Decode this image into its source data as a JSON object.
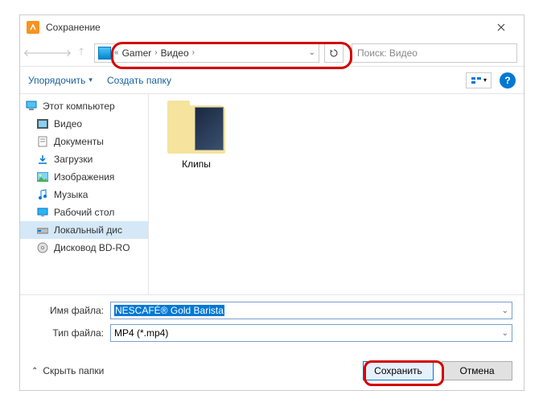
{
  "title": "Сохранение",
  "breadcrumb": {
    "parent": "Gamer",
    "current": "Видео",
    "sep_prefix": "«"
  },
  "search": {
    "placeholder": "Поиск: Видео"
  },
  "toolbar": {
    "organize": "Упорядочить",
    "new_folder": "Создать папку"
  },
  "tree": {
    "root": "Этот компьютер",
    "items": [
      "Видео",
      "Документы",
      "Загрузки",
      "Изображения",
      "Музыка",
      "Рабочий стол",
      "Локальный дис",
      "Дисковод BD-RO"
    ]
  },
  "folder_view": {
    "items": [
      {
        "name": "Клипы"
      }
    ]
  },
  "fields": {
    "filename_label": "Имя файла:",
    "filename_value": "NESCAFÉ® Gold Barista",
    "filetype_label": "Тип файла:",
    "filetype_value": "MP4 (*.mp4)"
  },
  "footer": {
    "hide_folders": "Скрыть папки",
    "save": "Сохранить",
    "cancel": "Отмена"
  }
}
